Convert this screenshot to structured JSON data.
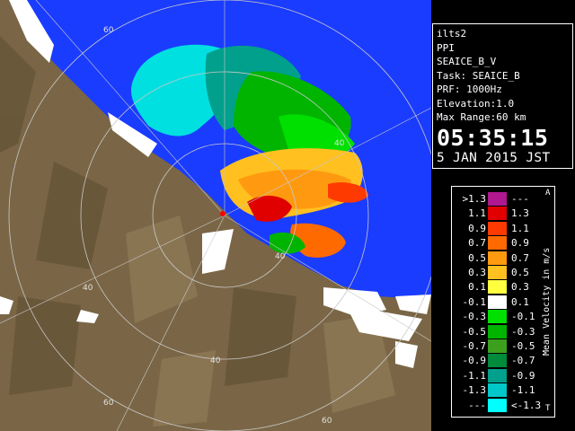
{
  "info": {
    "lines": [
      "ilts2",
      "PPI",
      "SEAICE_B_V",
      "Task: SEAICE_B",
      "PRF: 1000Hz",
      "Elevation:1.0",
      "Max Range:60 km"
    ],
    "time": "05:35:15",
    "date": "5 JAN 2015 JST"
  },
  "legend": {
    "title": "Mean Velocity in m/s",
    "top_mark": "A",
    "bottom_mark": "T",
    "rows": [
      {
        "lo": ">1.3",
        "hi": "---",
        "color": "#b01890"
      },
      {
        "lo": "1.1",
        "hi": "1.3",
        "color": "#e00000"
      },
      {
        "lo": "0.9",
        "hi": "1.1",
        "color": "#ff3a00"
      },
      {
        "lo": "0.7",
        "hi": "0.9",
        "color": "#ff6a00"
      },
      {
        "lo": "0.5",
        "hi": "0.7",
        "color": "#ff9a10"
      },
      {
        "lo": "0.3",
        "hi": "0.5",
        "color": "#ffc020"
      },
      {
        "lo": "0.1",
        "hi": "0.3",
        "color": "#ffff40"
      },
      {
        "lo": "-0.1",
        "hi": "0.1",
        "color": "#ffffff"
      },
      {
        "lo": "-0.3",
        "hi": "-0.1",
        "color": "#00e000"
      },
      {
        "lo": "-0.5",
        "hi": "-0.3",
        "color": "#00b400"
      },
      {
        "lo": "-0.7",
        "hi": "-0.5",
        "color": "#3ca01e"
      },
      {
        "lo": "-0.9",
        "hi": "-0.7",
        "color": "#008a3c"
      },
      {
        "lo": "-1.1",
        "hi": "-0.9",
        "color": "#00a08c"
      },
      {
        "lo": "-1.3",
        "hi": "-1.1",
        "color": "#00c8c8"
      },
      {
        "lo": "---",
        "hi": "<-1.3",
        "color": "#00ffff"
      }
    ]
  },
  "map": {
    "range_labels": [
      "60",
      "40",
      "40",
      "40",
      "40",
      "60",
      "60"
    ],
    "colors": {
      "sea": "#1a3cff",
      "land": "#7a6646",
      "ice": "#ffffff"
    }
  }
}
